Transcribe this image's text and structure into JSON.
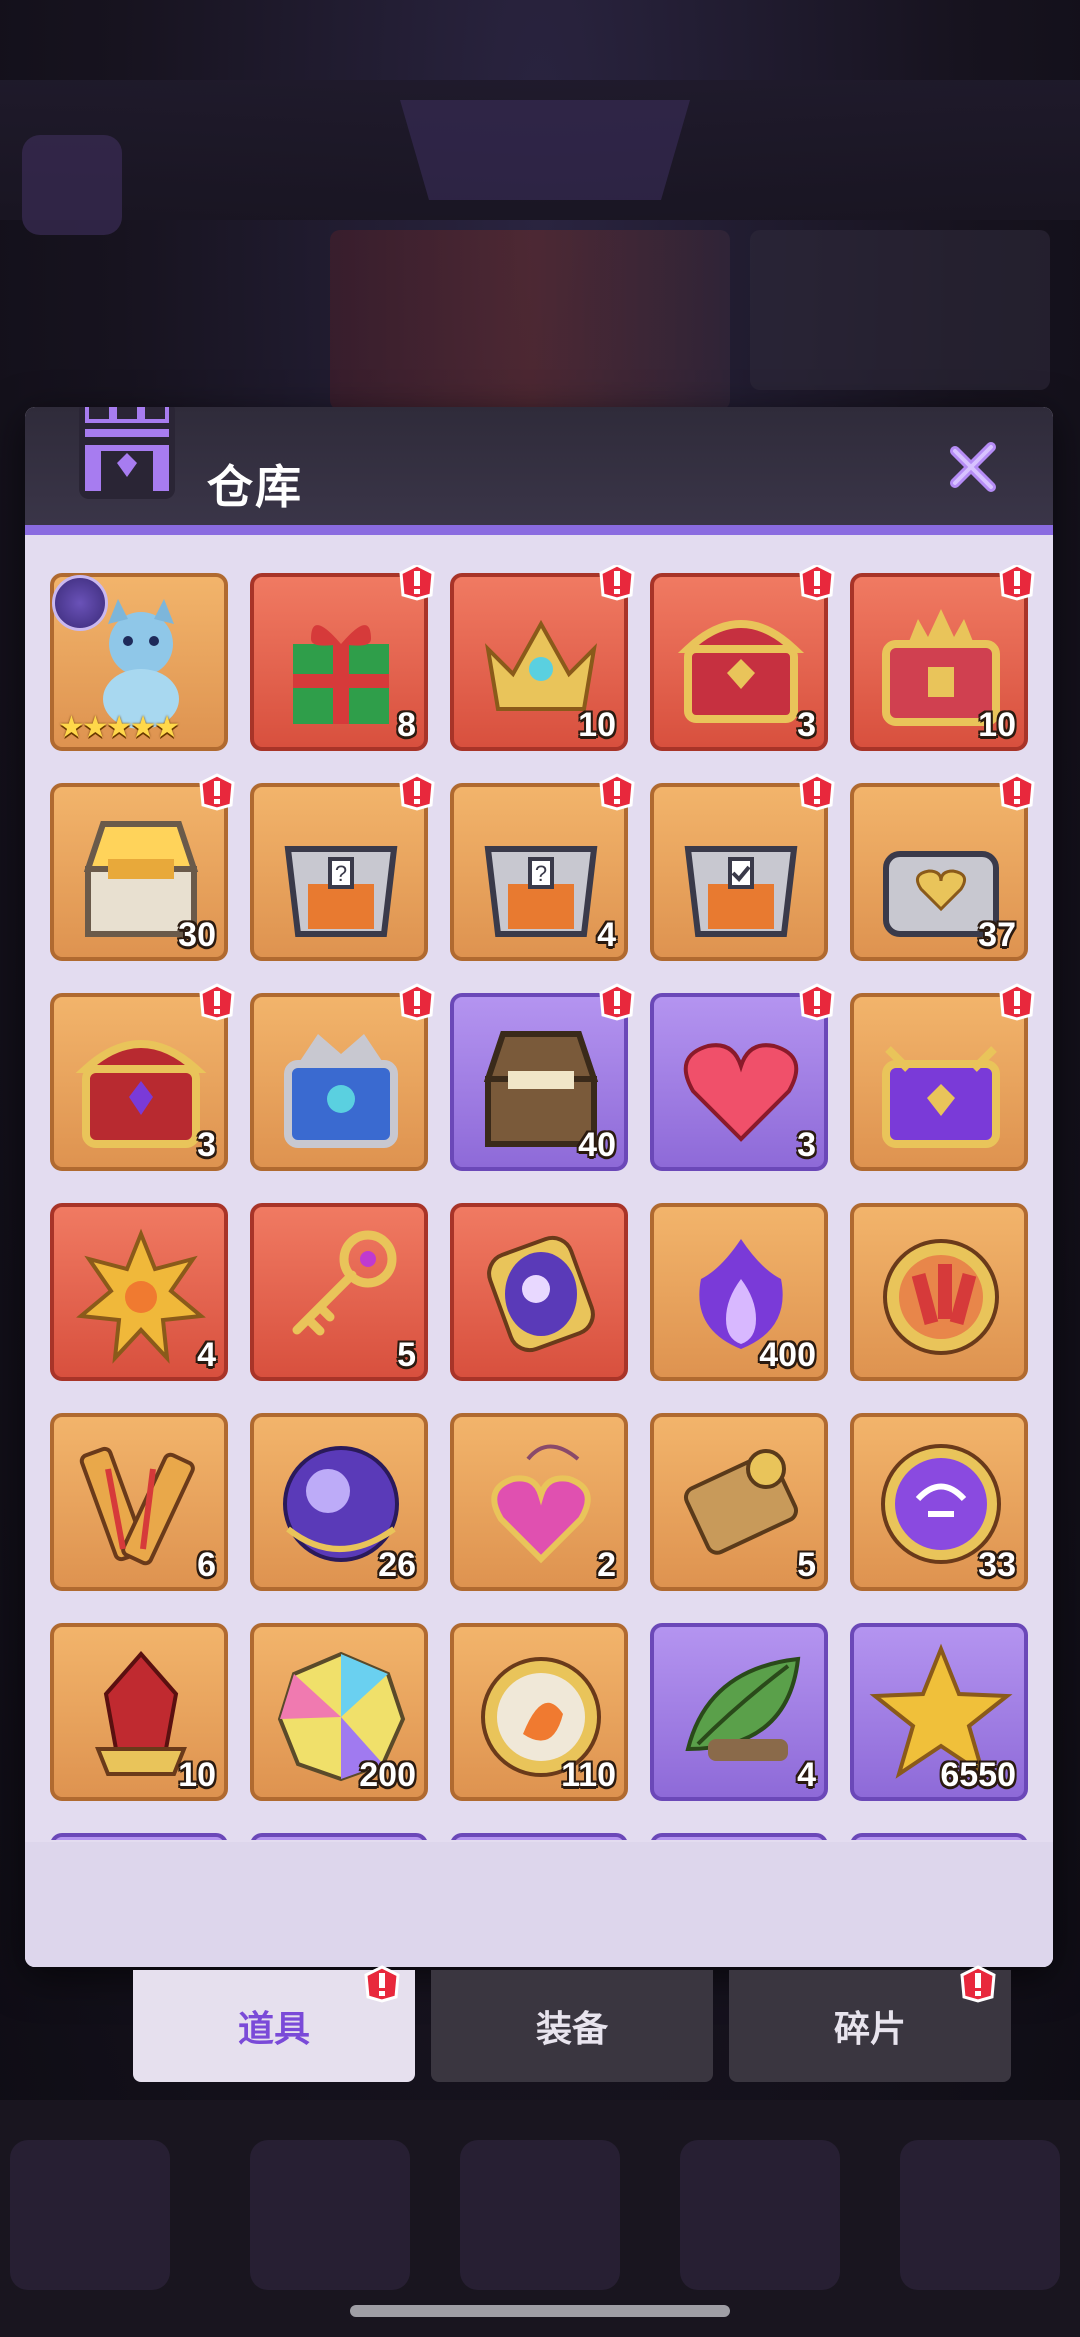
{
  "panel": {
    "title": "仓库",
    "accent_color": "#8a6be0"
  },
  "items": [
    {
      "icon": "blue-cat-hero-icon",
      "quantity": "",
      "bg": "orange",
      "stars": "★★★★★",
      "alert": false,
      "badge": "class-badge-icon"
    },
    {
      "icon": "gift-box-icon",
      "quantity": "8",
      "bg": "red",
      "alert": true
    },
    {
      "icon": "gold-crown-crest-icon",
      "quantity": "10",
      "bg": "red",
      "alert": true
    },
    {
      "icon": "gold-red-chest-icon",
      "quantity": "3",
      "bg": "red",
      "alert": true
    },
    {
      "icon": "royal-red-chest-icon",
      "quantity": "10",
      "bg": "red",
      "alert": true
    },
    {
      "icon": "open-treasure-chest-icon",
      "quantity": "30",
      "bg": "orange",
      "alert": true
    },
    {
      "icon": "mystery-armor-chest-icon",
      "quantity": "",
      "bg": "orange",
      "alert": true
    },
    {
      "icon": "mystery-armor-chest-icon",
      "quantity": "4",
      "bg": "orange",
      "alert": true
    },
    {
      "icon": "select-armor-chest-icon",
      "quantity": "",
      "bg": "orange",
      "alert": true
    },
    {
      "icon": "silver-heart-chest-icon",
      "quantity": "37",
      "bg": "orange",
      "alert": true
    },
    {
      "icon": "red-gem-chest-icon",
      "quantity": "3",
      "bg": "orange",
      "alert": true
    },
    {
      "icon": "blue-crown-chest-icon",
      "quantity": "",
      "bg": "orange",
      "alert": true
    },
    {
      "icon": "open-gold-chest-icon",
      "quantity": "40",
      "bg": "purple",
      "alert": true
    },
    {
      "icon": "red-heart-icon",
      "quantity": "3",
      "bg": "purple",
      "alert": true
    },
    {
      "icon": "purple-crest-chest-icon",
      "quantity": "",
      "bg": "orange",
      "alert": true
    },
    {
      "icon": "golden-star-burst-icon",
      "quantity": "4",
      "bg": "red",
      "alert": false
    },
    {
      "icon": "ornate-key-icon",
      "quantity": "5",
      "bg": "red",
      "alert": false
    },
    {
      "icon": "galaxy-orb-amulet-icon",
      "quantity": "",
      "bg": "red",
      "alert": false
    },
    {
      "icon": "purple-flame-icon",
      "quantity": "400",
      "bg": "orange",
      "alert": false
    },
    {
      "icon": "fireworks-medal-icon",
      "quantity": "",
      "bg": "orange",
      "alert": false
    },
    {
      "icon": "firework-tubes-icon",
      "quantity": "6",
      "bg": "orange",
      "alert": false
    },
    {
      "icon": "crystal-ball-icon",
      "quantity": "26",
      "bg": "orange",
      "alert": false
    },
    {
      "icon": "heart-pendant-icon",
      "quantity": "2",
      "bg": "orange",
      "alert": false
    },
    {
      "icon": "scroll-icon",
      "quantity": "5",
      "bg": "orange",
      "alert": false
    },
    {
      "icon": "purple-rune-coin-icon",
      "quantity": "33",
      "bg": "orange",
      "alert": false
    },
    {
      "icon": "red-crystal-icon",
      "quantity": "10",
      "bg": "orange",
      "alert": false
    },
    {
      "icon": "rainbow-gem-icon",
      "quantity": "200",
      "bg": "orange",
      "alert": false
    },
    {
      "icon": "fire-orb-icon",
      "quantity": "110",
      "bg": "orange",
      "alert": false
    },
    {
      "icon": "leaf-icon",
      "quantity": "4",
      "bg": "purple",
      "alert": false
    },
    {
      "icon": "gold-star-icon",
      "quantity": "6550",
      "bg": "purple",
      "alert": false
    }
  ],
  "partial_row": [
    "purple",
    "purple",
    "purple",
    "purple",
    "purple"
  ],
  "tabs": [
    {
      "label": "道具",
      "active": true,
      "alert": true
    },
    {
      "label": "装备",
      "active": false,
      "alert": false
    },
    {
      "label": "碎片",
      "active": false,
      "alert": true
    }
  ],
  "colors": {
    "orange_tile": "#e8a35d",
    "red_tile": "#e46550",
    "purple_tile": "#a17ee4",
    "alert_red": "#e8283c",
    "active_tab_text": "#7a4ad8"
  }
}
